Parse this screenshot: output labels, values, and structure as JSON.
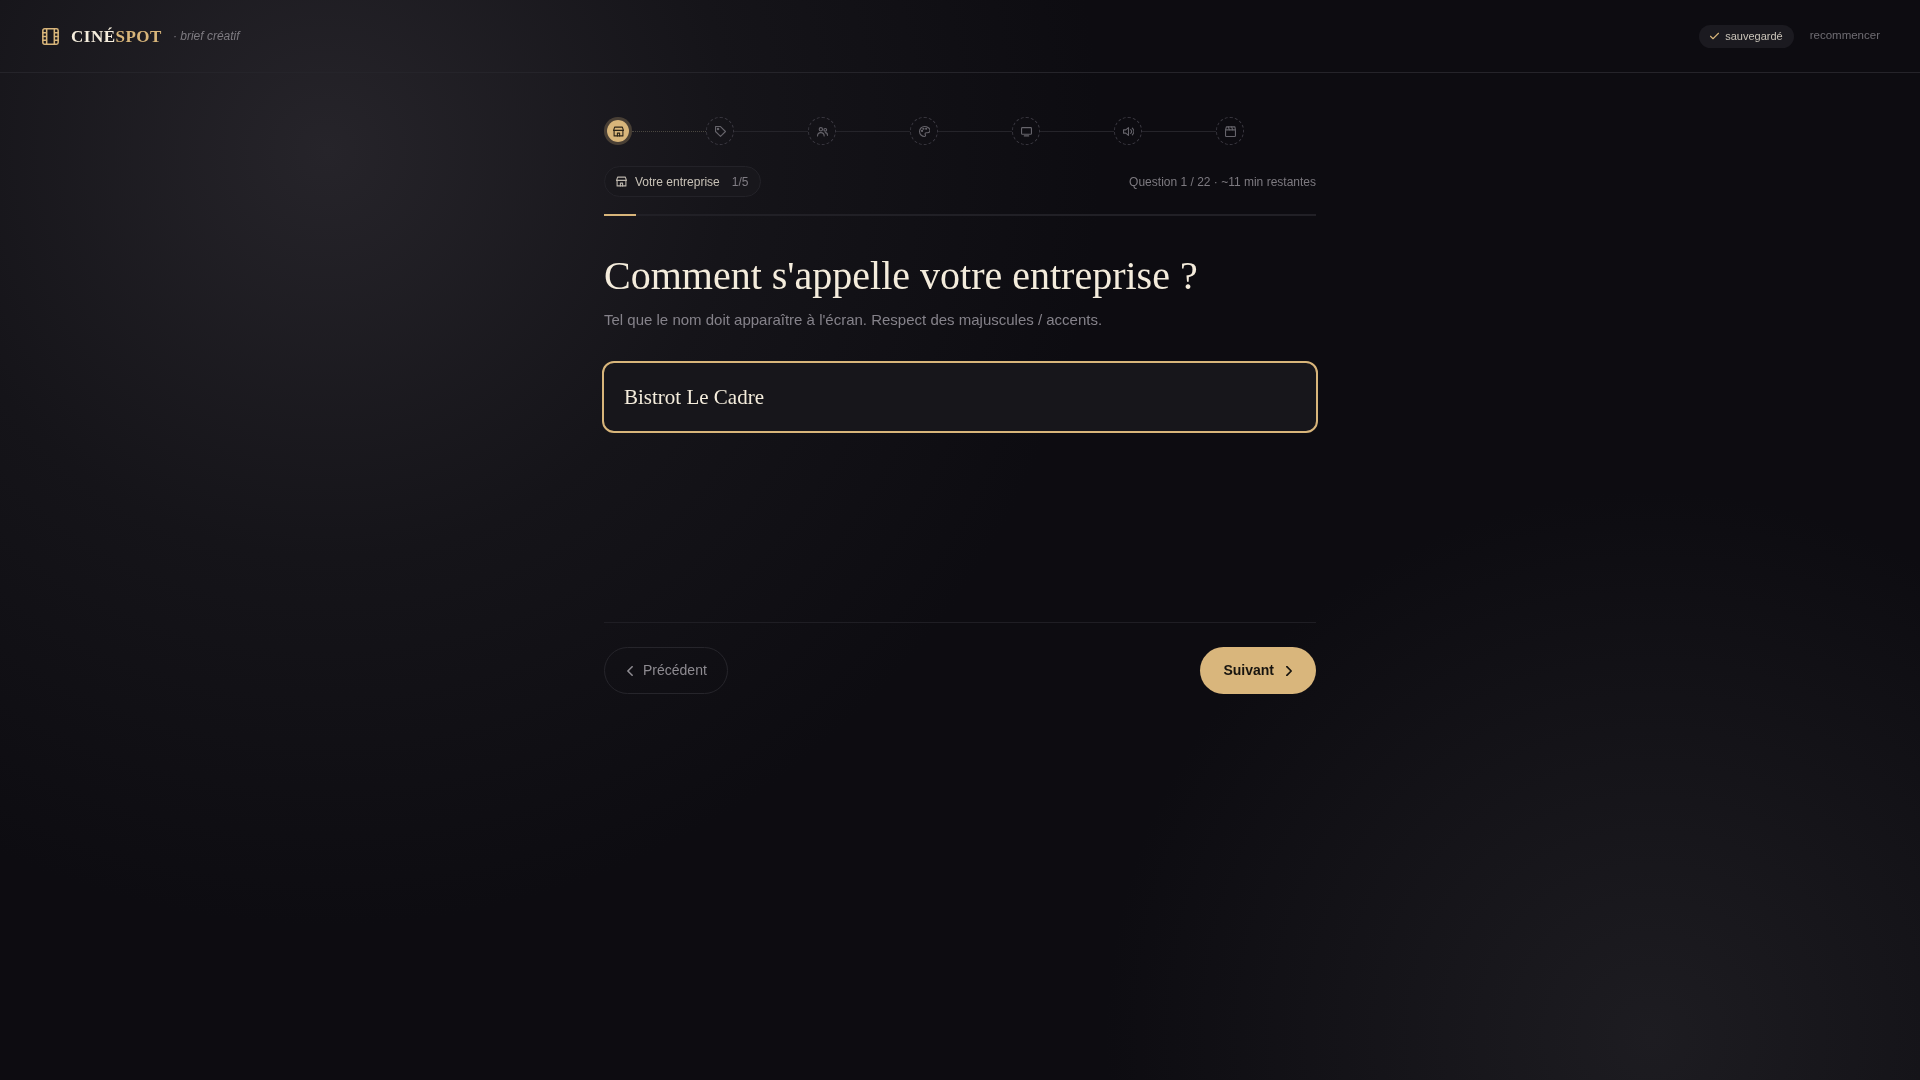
{
  "header": {
    "brand": {
      "part_1": "CINÉ",
      "part_2": "SPOT"
    },
    "tagline": "· brief créatif",
    "save_status": "sauvegardé",
    "restart_link": "recommencer"
  },
  "stepper": {
    "steps": [
      {
        "selected": true
      },
      {
        "selected": false
      },
      {
        "selected": false
      },
      {
        "selected": false
      },
      {
        "selected": false
      },
      {
        "selected": false
      },
      {
        "selected": false
      }
    ]
  },
  "section_badge": {
    "label": "Votre entreprise",
    "count": "1/5"
  },
  "progress_text": "Question 1 / 22 · ~11 min restantes",
  "progress": {
    "level": 0.045
  },
  "question": {
    "title": "Comment s'appelle votre entreprise ?",
    "hint": "Tel que le nom doit apparaître à l'écran. Respect des majuscules / accents."
  },
  "answer_field": {
    "value": "Bistrot Le Cadre",
    "focused": true
  },
  "navigation": {
    "previous": "Précédent",
    "next": "Suivant"
  }
}
